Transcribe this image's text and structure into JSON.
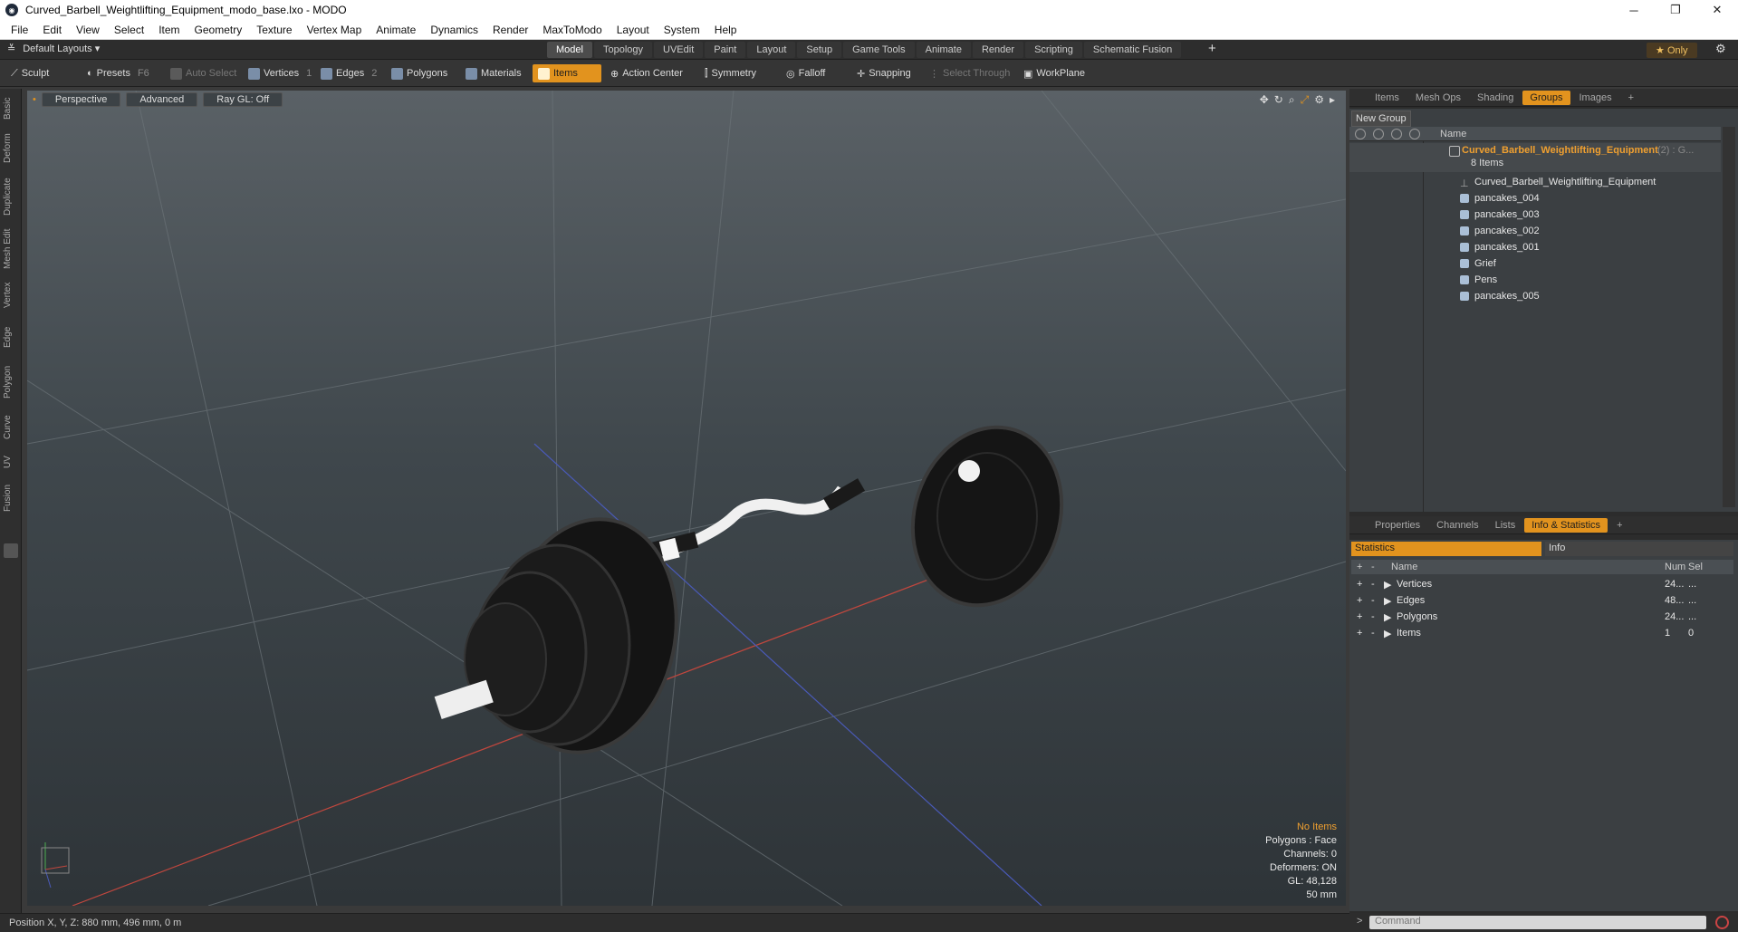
{
  "window": {
    "title": "Curved_Barbell_Weightlifting_Equipment_modo_base.lxo - MODO",
    "controls": [
      "─",
      "❐",
      "✕"
    ]
  },
  "menu": [
    "File",
    "Edit",
    "View",
    "Select",
    "Item",
    "Geometry",
    "Texture",
    "Vertex Map",
    "Animate",
    "Dynamics",
    "Render",
    "MaxToModo",
    "Layout",
    "System",
    "Help"
  ],
  "layoutbar": {
    "layouts_label": "Default Layouts",
    "tabs": [
      "Model",
      "Topology",
      "UVEdit",
      "Paint",
      "Layout",
      "Setup",
      "Game Tools",
      "Animate",
      "Render",
      "Scripting",
      "Schematic Fusion"
    ],
    "active_tab": "Model",
    "only_label": "Only"
  },
  "toolbar": {
    "sculpt": "Sculpt",
    "presets": "Presets",
    "presets_key": "F6",
    "auto_select": "Auto Select",
    "vertices": "Vertices",
    "vertices_key": "1",
    "edges": "Edges",
    "edges_key": "2",
    "polygons": "Polygons",
    "materials": "Materials",
    "items": "Items",
    "action_center": "Action Center",
    "symmetry": "Symmetry",
    "falloff": "Falloff",
    "snapping": "Snapping",
    "select_through": "Select Through",
    "workplane": "WorkPlane"
  },
  "lefttabs": [
    "Basic",
    "Deform",
    "Duplicate",
    "Mesh Edit",
    "Vertex",
    "Edge",
    "Polygon",
    "Curve",
    "UV",
    "Fusion"
  ],
  "viewport": {
    "perspective": "Perspective",
    "advanced": "Advanced",
    "raygl": "Ray GL: Off",
    "stats": {
      "no_items": "No Items",
      "polygons": "Polygons : Face",
      "channels": "Channels: 0",
      "deformers": "Deformers: ON",
      "gl": "GL: 48,128",
      "scale": "50 mm"
    }
  },
  "status": {
    "position": "Position X, Y, Z:  880 mm, 496 mm, 0 m"
  },
  "groups_panel": {
    "tabs": [
      "Items",
      "Mesh Ops",
      "Shading",
      "Groups",
      "Images"
    ],
    "active_tab": "Groups",
    "new_group": "New Group",
    "name_col": "Name",
    "root": {
      "name": "Curved_Barbell_Weightlifting_Equipment",
      "suffix": "(2) : G...",
      "count": "8 Items"
    },
    "children": [
      "Curved_Barbell_Weightlifting_Equipment",
      "pancakes_004",
      "pancakes_003",
      "pancakes_002",
      "pancakes_001",
      "Grief",
      "Pens",
      "pancakes_005"
    ]
  },
  "info_panel": {
    "tabs": [
      "Properties",
      "Channels",
      "Lists",
      "Info & Statistics"
    ],
    "active_tab": "Info & Statistics",
    "statistics": "Statistics",
    "info": "Info",
    "cols": {
      "name": "Name",
      "num": "Num",
      "sel": "Sel"
    },
    "rows": [
      {
        "name": "Vertices",
        "num": "24...",
        "sel": "..."
      },
      {
        "name": "Edges",
        "num": "48...",
        "sel": "..."
      },
      {
        "name": "Polygons",
        "num": "24...",
        "sel": "..."
      },
      {
        "name": "Items",
        "num": "1",
        "sel": "0"
      }
    ]
  },
  "command": {
    "placeholder": "Command"
  }
}
